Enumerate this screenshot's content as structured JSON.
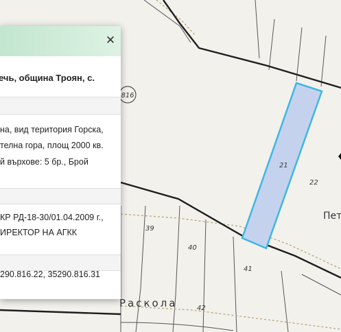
{
  "map": {
    "plot_labels": {
      "p21": "21",
      "p22": "22",
      "p39": "39",
      "p40": "40",
      "p41": "41",
      "p42": "42"
    },
    "road_badge": "816",
    "place_label": "Раскола",
    "edge_label": "Пет",
    "colors": {
      "background": "#f2f1ec",
      "selected_fill": "#c5d2ee",
      "selected_stroke": "#3db7e4",
      "road": "#1e1e1e",
      "boundary": "#444444",
      "trail": "#c8b98c"
    }
  },
  "popup": {
    "close_glyph": "✕",
    "title": "ечь, община Троян, с.",
    "desc_line1": "на, вид територия Горска,",
    "desc_line2": "телна гора, площ 2000 кв.",
    "desc_line3": "й върхове: 5 бр., Брой",
    "order_line1": "КР РД-18-30/01.04.2009 г.,",
    "order_line2": "ИРЕКТОР НА АГКК",
    "ids": "290.816.22, 35290.816.31"
  }
}
